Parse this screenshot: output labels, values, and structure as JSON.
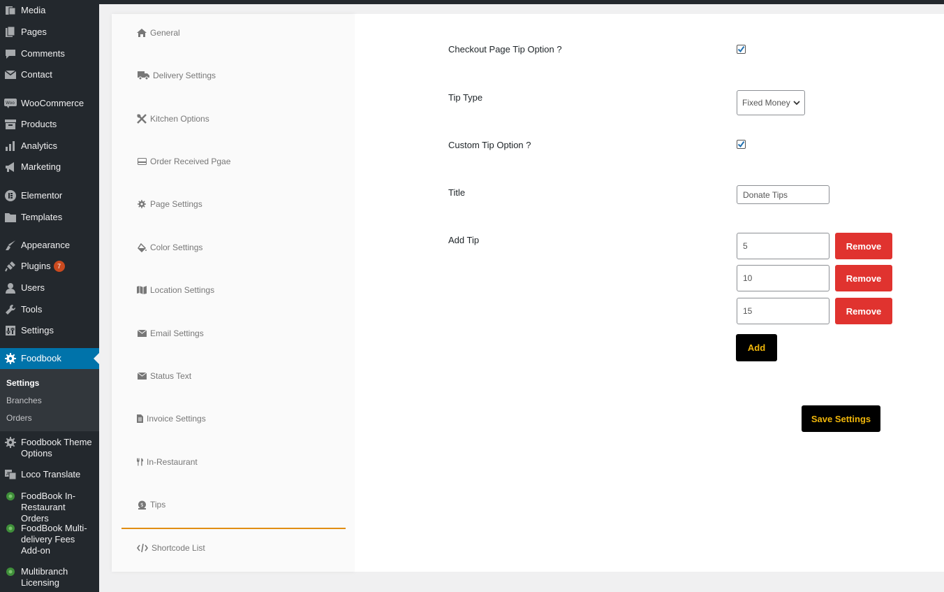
{
  "sidebar": {
    "items": [
      {
        "name": "media",
        "label": "Media",
        "icon": "media-icon"
      },
      {
        "name": "pages",
        "label": "Pages",
        "icon": "pages-icon"
      },
      {
        "name": "comments",
        "label": "Comments",
        "icon": "comments-icon"
      },
      {
        "name": "contact",
        "label": "Contact",
        "icon": "envelope-icon"
      },
      {
        "name": "woocommerce",
        "label": "WooCommerce",
        "icon": "woo-icon"
      },
      {
        "name": "products",
        "label": "Products",
        "icon": "archive-icon"
      },
      {
        "name": "analytics",
        "label": "Analytics",
        "icon": "bar-chart-icon"
      },
      {
        "name": "marketing",
        "label": "Marketing",
        "icon": "megaphone-icon"
      },
      {
        "name": "elementor",
        "label": "Elementor",
        "icon": "elementor-icon"
      },
      {
        "name": "templates",
        "label": "Templates",
        "icon": "folder-icon"
      },
      {
        "name": "appearance",
        "label": "Appearance",
        "icon": "brush-icon"
      },
      {
        "name": "plugins",
        "label": "Plugins",
        "icon": "plug-icon",
        "badge": "7"
      },
      {
        "name": "users",
        "label": "Users",
        "icon": "user-icon"
      },
      {
        "name": "tools",
        "label": "Tools",
        "icon": "wrench-icon"
      },
      {
        "name": "settings",
        "label": "Settings",
        "icon": "sliders-icon"
      },
      {
        "name": "foodbook",
        "label": "Foodbook",
        "icon": "gear-icon"
      },
      {
        "name": "foodbook-theme-options",
        "label": "Foodbook Theme Options",
        "icon": "gear-icon"
      },
      {
        "name": "loco-translate",
        "label": "Loco Translate",
        "icon": "translate-icon"
      },
      {
        "name": "foodbook-in-restaurant-orders",
        "label": "FoodBook In-Restaurant Orders",
        "icon": "leaf-icon"
      },
      {
        "name": "foodbook-multi-delivery",
        "label": "FoodBook Multi-delivery Fees Add-on",
        "icon": "leaf-icon"
      },
      {
        "name": "multibranch-licensing",
        "label": "Multibranch Licensing",
        "icon": "leaf-icon"
      }
    ],
    "submenu": [
      "Settings",
      "Branches",
      "Orders"
    ]
  },
  "settings_nav": {
    "items": [
      {
        "label": "General",
        "icon": "home-icon"
      },
      {
        "label": "Delivery Settings",
        "icon": "truck-icon"
      },
      {
        "label": "Kitchen Options",
        "icon": "tools-icon"
      },
      {
        "label": "Order Received Pgae",
        "icon": "card-icon"
      },
      {
        "label": "Page Settings",
        "icon": "gear-icon"
      },
      {
        "label": "Color Settings",
        "icon": "paint-bucket-icon"
      },
      {
        "label": "Location Settings",
        "icon": "map-icon"
      },
      {
        "label": "Email Settings",
        "icon": "envelope-icon"
      },
      {
        "label": "Status Text",
        "icon": "envelope-icon"
      },
      {
        "label": "Invoice Settings",
        "icon": "file-icon"
      },
      {
        "label": "In-Restaurant",
        "icon": "utensils-icon"
      },
      {
        "label": "Tips",
        "icon": "coin-icon"
      },
      {
        "label": "Shortcode List",
        "icon": "code-icon"
      }
    ],
    "active": "Tips"
  },
  "form": {
    "checkout_tip_label": "Checkout Page Tip Option ?",
    "checkout_tip_checked": true,
    "tip_type_label": "Tip Type",
    "tip_type_value": "Fixed Money",
    "custom_tip_label": "Custom Tip Option ?",
    "custom_tip_checked": true,
    "title_label": "Title",
    "title_value": "Donate Tips",
    "add_tip_label": "Add Tip",
    "tips": [
      "5",
      "10",
      "15"
    ],
    "remove_label": "Remove",
    "add_label": "Add",
    "save_label": "Save Settings"
  },
  "colors": {
    "sidebar_bg": "#23282d",
    "sidebar_active": "#0073aa",
    "remove_button": "#e0332f",
    "dark_button": "#000000",
    "button_text": "#f0b60a",
    "active_tab_line": "#e08d13"
  }
}
